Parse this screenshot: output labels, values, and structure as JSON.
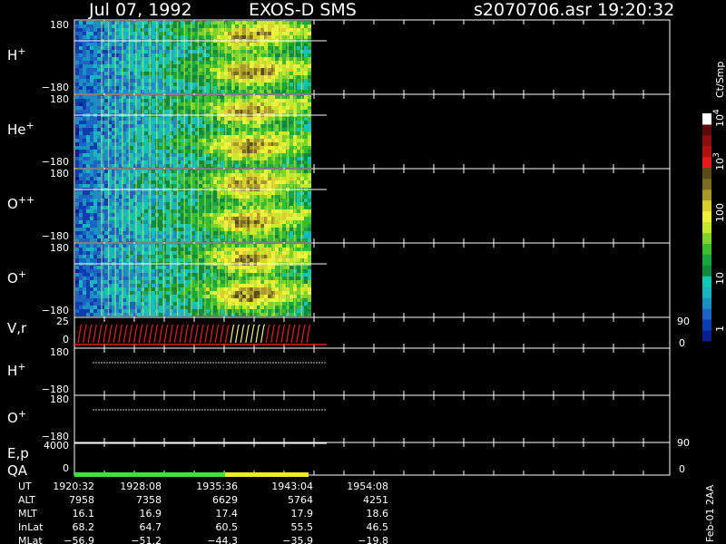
{
  "header": {
    "date": "Jul 07, 1992",
    "instrument": "EXOS-D SMS",
    "file": "s2070706.asr",
    "time": "19:20:32"
  },
  "colorbar": {
    "unit": "Ct/Smp",
    "ticks": [
      "1",
      "10",
      "100",
      "10",
      "10"
    ],
    "tick_exponents": [
      "",
      "",
      "",
      "3",
      "4"
    ],
    "colors": [
      "#0a1f8f",
      "#0b3db0",
      "#1c63c4",
      "#1b8fc2",
      "#18b5c0",
      "#12c7ad",
      "#128a3c",
      "#1aa63a",
      "#3cbd2e",
      "#7ed32a",
      "#c6e82a",
      "#eef23a",
      "#d7cf2e",
      "#a89a2a",
      "#7a6a22",
      "#5b4a1a",
      "#e61a1a",
      "#b31212",
      "#8a1010",
      "#5e0a0a",
      "#ffffff"
    ]
  },
  "panels": [
    {
      "label": "H",
      "sup": "+",
      "top": "180",
      "bottom": "−180"
    },
    {
      "label": "He",
      "sup": "+",
      "top": "180",
      "bottom": "−180"
    },
    {
      "label": "O",
      "sup": "++",
      "top": "180",
      "bottom": "−180"
    },
    {
      "label": "O",
      "sup": "+",
      "top": "180",
      "bottom": "−180"
    }
  ],
  "vr_panel": {
    "label": "V,r",
    "left_top": "25",
    "left_bottom": "0",
    "right_top": "90",
    "right_bottom": "0"
  },
  "line_panels": [
    {
      "label": "H",
      "sup": "+",
      "top": "180",
      "bottom": "−180"
    },
    {
      "label": "O",
      "sup": "+",
      "top": "180",
      "bottom": "−180"
    }
  ],
  "ep_panel": {
    "label1": "E,p",
    "label2": "QA",
    "left_top": "4000",
    "left_bottom": "0",
    "right_top": "90",
    "right_bottom": "0"
  },
  "qa_bar": [
    {
      "status": "good",
      "color": "#44dd44",
      "from": "1920:32",
      "to": "1935:36"
    },
    {
      "status": "caution",
      "color": "#eeee22",
      "from": "1935:36",
      "to": "1943:04"
    }
  ],
  "ephemeris": {
    "row_labels": [
      "UT",
      "ALT",
      "MLT",
      "InLat",
      "MLat"
    ],
    "columns": [
      {
        "UT": "1920:32",
        "ALT": "7958",
        "MLT": "16.1",
        "InLat": "68.2",
        "MLat": "−56.9"
      },
      {
        "UT": "1928:08",
        "ALT": "7358",
        "MLT": "16.9",
        "InLat": "64.7",
        "MLat": "−51.2"
      },
      {
        "UT": "1935:36",
        "ALT": "6629",
        "MLT": "17.4",
        "InLat": "60.5",
        "MLat": "−44.3"
      },
      {
        "UT": "1943:04",
        "ALT": "5764",
        "MLT": "17.9",
        "InLat": "55.5",
        "MLat": "−35.9"
      },
      {
        "UT": "1954:08",
        "ALT": "4251",
        "MLT": "18.6",
        "InLat": "46.5",
        "MLat": "−19.8"
      }
    ]
  },
  "side_note": "Feb-01 2AA",
  "chart_data": {
    "type": "heatmap",
    "title": "Jul 07, 1992   EXOS-D SMS",
    "x_axis": {
      "label": "UT",
      "ticks": [
        "1920:32",
        "1928:08",
        "1935:36",
        "1943:04",
        "1954:08"
      ]
    },
    "y_axis": {
      "range": [
        -180,
        180
      ]
    },
    "series": [
      {
        "name": "H+",
        "ylim": [
          -180,
          180
        ]
      },
      {
        "name": "He+",
        "ylim": [
          -180,
          180
        ]
      },
      {
        "name": "O++",
        "ylim": [
          -180,
          180
        ]
      },
      {
        "name": "O+",
        "ylim": [
          -180,
          180
        ]
      }
    ],
    "colorscale": {
      "unit": "Ct/Smp",
      "scale": "log",
      "range": [
        1,
        10000
      ]
    },
    "data_coverage": {
      "from": "1920:32",
      "to": "1943:04"
    }
  }
}
